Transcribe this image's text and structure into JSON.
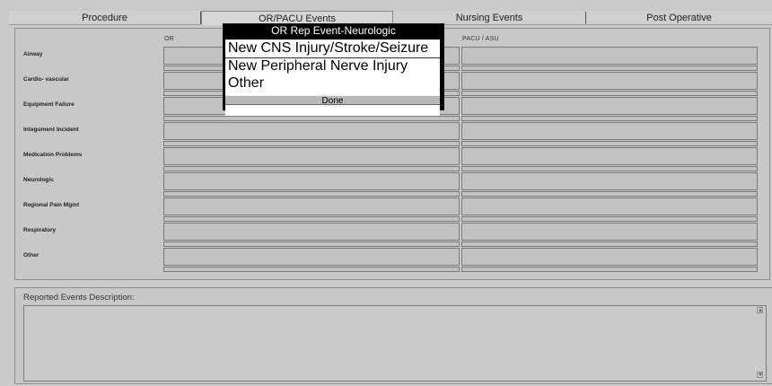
{
  "tabs": [
    {
      "label": "Procedure"
    },
    {
      "label": "OR/PACU Events",
      "active": true
    },
    {
      "label": "Nursing Events"
    },
    {
      "label": "Post Operative"
    }
  ],
  "columns": {
    "or": "OR",
    "pacu": "PACU / ASU"
  },
  "rows": [
    {
      "label": "Airway"
    },
    {
      "label": "Cardio- vascular"
    },
    {
      "label": "Equipment Failure"
    },
    {
      "label": "Integument Incident"
    },
    {
      "label": "Medication Problems"
    },
    {
      "label": "Neurologic"
    },
    {
      "label": "Regional Pain Mgmt"
    },
    {
      "label": "Respiratory"
    },
    {
      "label": "Other"
    }
  ],
  "description": {
    "label": "Reported Events Description:",
    "value": ""
  },
  "popup": {
    "title": "OR Rep Event-Neurologic",
    "items": [
      "New CNS Injury/Stroke/Seizure",
      "New Peripheral Nerve Injury",
      "Other"
    ],
    "done_label": "Done"
  }
}
